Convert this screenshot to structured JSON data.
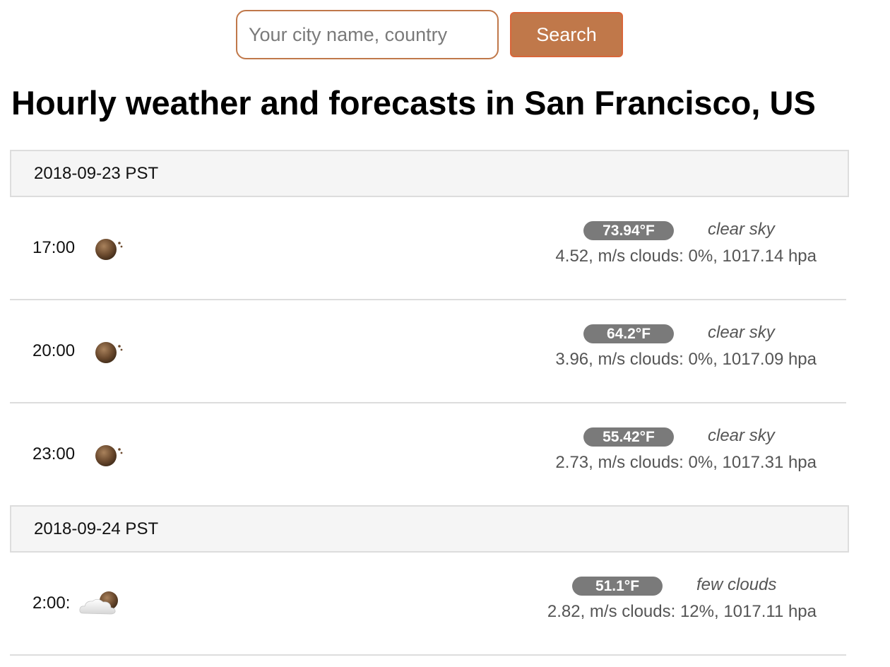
{
  "search": {
    "placeholder": "Your city name, country",
    "button_label": "Search"
  },
  "page_title": "Hourly weather and forecasts in San Francisco, US",
  "colors": {
    "accent": "#c0784a",
    "badge": "#7a7a7a",
    "header_bg": "#f5f5f5"
  },
  "days": [
    {
      "date": "2018-09-23 PST",
      "hours": [
        {
          "time": "17:00",
          "icon": "clear-sky-night-icon",
          "temp": "73.94°F",
          "desc": "clear sky",
          "details": "4.52, m/s clouds: 0%, 1017.14 hpa"
        },
        {
          "time": "20:00",
          "icon": "clear-sky-night-icon",
          "temp": "64.2°F",
          "desc": "clear sky",
          "details": "3.96, m/s clouds: 0%, 1017.09 hpa"
        },
        {
          "time": "23:00",
          "icon": "clear-sky-night-icon",
          "temp": "55.42°F",
          "desc": "clear sky",
          "details": "2.73, m/s clouds: 0%, 1017.31 hpa"
        }
      ]
    },
    {
      "date": "2018-09-24 PST",
      "hours": [
        {
          "time": "2:00:",
          "icon": "few-clouds-night-icon",
          "temp": "51.1°F",
          "desc": "few clouds",
          "details": "2.82, m/s clouds: 12%, 1017.11 hpa"
        }
      ]
    }
  ]
}
